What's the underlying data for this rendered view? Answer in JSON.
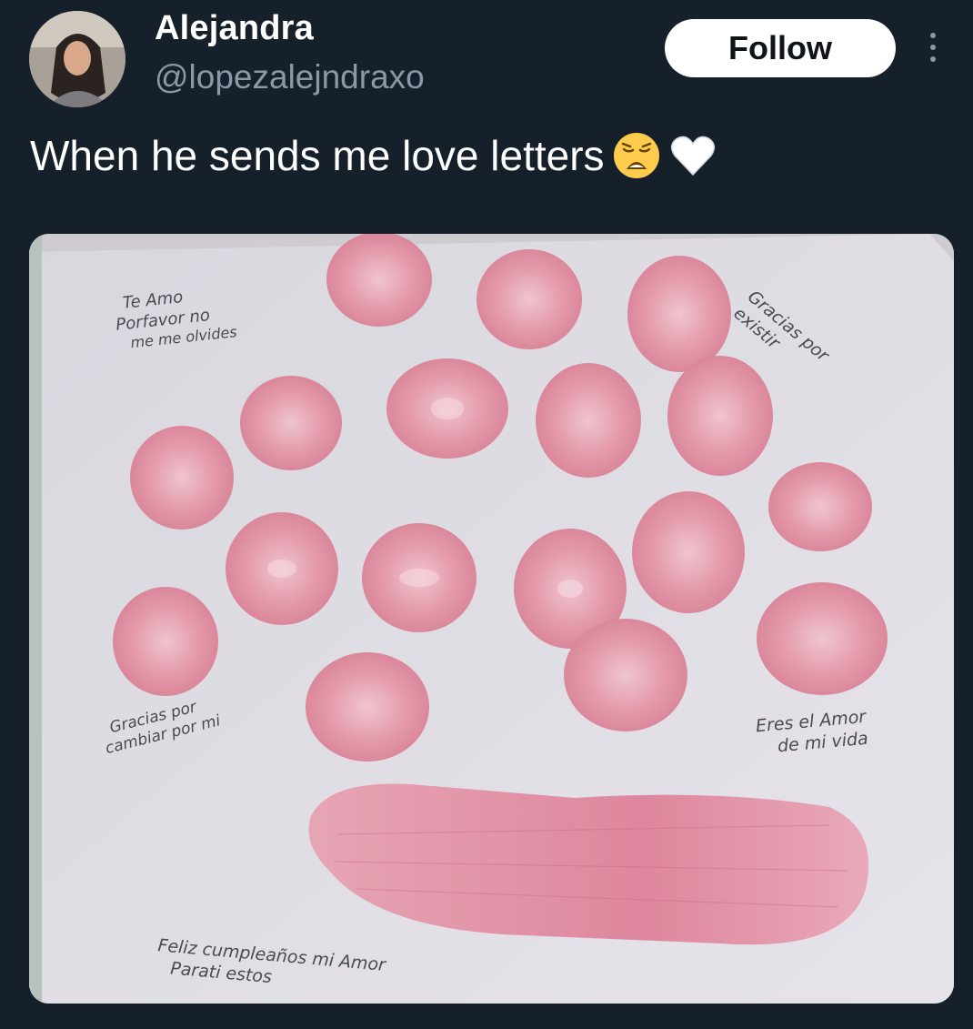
{
  "author": {
    "display_name": "Alejandra",
    "handle": "@lopezalejndraxo",
    "avatar_icon": "profile-photo"
  },
  "actions": {
    "follow_label": "Follow",
    "more_icon": "more-vertical-icon"
  },
  "tweet": {
    "text": "When he sends me love letters",
    "emojis": [
      "weary-face-emoji",
      "white-heart-emoji"
    ]
  },
  "media": {
    "description_kind": "photo",
    "notes": [
      {
        "lines": [
          "Te Amo",
          "Porfavor no",
          "me me olvides"
        ]
      },
      {
        "lines": [
          "Gracias por",
          "existir"
        ]
      },
      {
        "lines": [
          "Gracias por",
          "cambiar por mi"
        ]
      },
      {
        "lines": [
          "Eres el Amor",
          "de mi vida"
        ]
      },
      {
        "lines": [
          "Feliz cumpleaños mi Amor",
          "Parati estos"
        ]
      }
    ]
  },
  "colors": {
    "background": "#15202b",
    "secondary_text": "#8b98a5",
    "follow_button_bg": "#ffffff",
    "kiss_pink": "#e58aa0"
  }
}
